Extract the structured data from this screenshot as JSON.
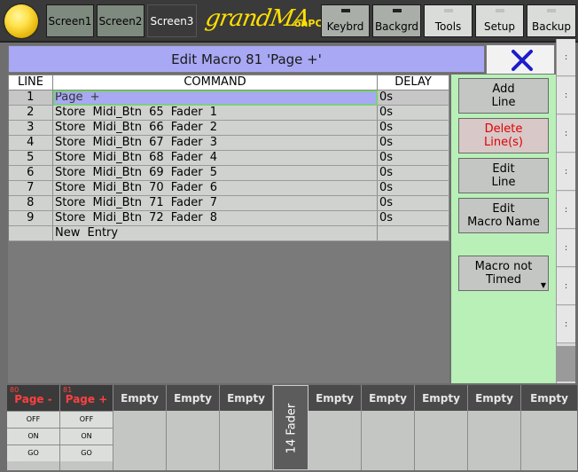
{
  "topbar": {
    "screens": [
      "Screen1",
      "Screen2",
      "Screen3"
    ],
    "active_screen": "Screen3",
    "logo_text": "grandMA",
    "logo_suffix": "onPC",
    "keys": [
      "Keybrd",
      "Backgrd",
      "Tools",
      "Setup",
      "Backup"
    ]
  },
  "window": {
    "title": "Edit Macro 81  'Page +'",
    "close_icon": "close-x-icon"
  },
  "table": {
    "headers": [
      "LINE",
      "COMMAND",
      "DELAY"
    ],
    "rows": [
      {
        "line": "1",
        "command": "Page  +",
        "delay": "0s"
      },
      {
        "line": "2",
        "command": "Store Midi_Btn 65 Fader 1",
        "delay": "0s"
      },
      {
        "line": "3",
        "command": "Store Midi_Btn 66 Fader 2",
        "delay": "0s"
      },
      {
        "line": "4",
        "command": "Store Midi_Btn 67 Fader 3",
        "delay": "0s"
      },
      {
        "line": "5",
        "command": "Store Midi_Btn 68 Fader 4",
        "delay": "0s"
      },
      {
        "line": "6",
        "command": "Store Midi_Btn 69 Fader 5",
        "delay": "0s"
      },
      {
        "line": "7",
        "command": "Store Midi_Btn 70 Fader 6",
        "delay": "0s"
      },
      {
        "line": "8",
        "command": "Store Midi_Btn 71 Fader 7",
        "delay": "0s"
      },
      {
        "line": "9",
        "command": "Store Midi_Btn 72 Fader 8",
        "delay": "0s"
      }
    ],
    "new_entry": "New Entry"
  },
  "actions": {
    "add_line": [
      "Add",
      "Line"
    ],
    "delete_line": [
      "Delete",
      "Line(s)"
    ],
    "edit_line": [
      "Edit",
      "Line"
    ],
    "edit_macro_name": [
      "Edit",
      "Macro Name"
    ],
    "macro_timing": [
      "Macro not",
      "Timed"
    ]
  },
  "scroll_buttons": [
    ":",
    ":",
    ":",
    ":",
    ":",
    ":",
    ":",
    ":"
  ],
  "executors": {
    "macros": [
      {
        "num": "80",
        "name": "Page -",
        "buttons": [
          "OFF",
          "ON",
          "GO"
        ]
      },
      {
        "num": "81",
        "name": "Page +",
        "buttons": [
          "OFF",
          "ON",
          "GO"
        ]
      }
    ],
    "empty_label": "Empty",
    "fader_label": "14 Fader"
  },
  "colors": {
    "title_bg": "#a8a8f4",
    "panel_bg": "#b8f0b8",
    "delete_text": "#e00000",
    "logo": "#ffe000"
  }
}
